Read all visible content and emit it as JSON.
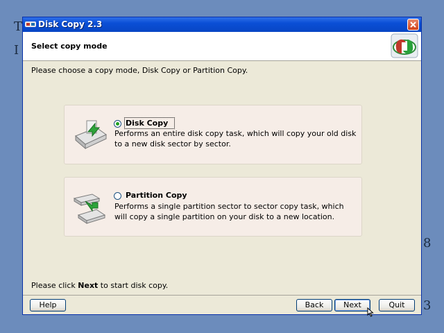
{
  "window": {
    "title": "Disk Copy 2.3"
  },
  "header": {
    "title": "Select copy mode",
    "logo_icon": "disk-copy-logo-icon"
  },
  "instruction": "Please choose a copy mode, Disk Copy or Partition Copy.",
  "options": [
    {
      "title": "Disk Copy",
      "description": "Performs an entire disk copy task, which will copy your old disk to a new disk sector by sector.",
      "selected": true,
      "icon": "disk-copy-icon"
    },
    {
      "title": "Partition Copy",
      "description": "Performs a single partition sector to sector copy task, which will copy a single partition on your disk to a new location.",
      "selected": false,
      "icon": "partition-copy-icon"
    }
  ],
  "bottom_text": {
    "prefix": "Please click ",
    "bold": "Next",
    "suffix": " to start disk copy."
  },
  "buttons": {
    "help": "Help",
    "back": "Back",
    "next": "Next",
    "quit": "Quit"
  },
  "colors": {
    "desktop": "#6c8cbc",
    "titlebar": "#0a4fd6",
    "dialog_bg": "#ece9d8",
    "panel_bg": "#f6ede7",
    "radio_selected": "#21a121"
  }
}
